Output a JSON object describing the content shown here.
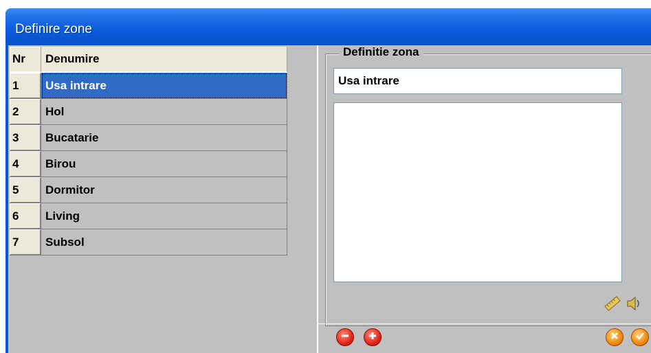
{
  "window": {
    "title": "Definire zone"
  },
  "grid": {
    "columns": [
      "Nr",
      "Denumire"
    ],
    "rows": [
      {
        "nr": "1",
        "name": "Usa intrare"
      },
      {
        "nr": "2",
        "name": "Hol"
      },
      {
        "nr": "3",
        "name": "Bucatarie"
      },
      {
        "nr": "4",
        "name": "Birou"
      },
      {
        "nr": "5",
        "name": "Dormitor"
      },
      {
        "nr": "6",
        "name": "Living"
      },
      {
        "nr": "7",
        "name": "Subsol"
      }
    ],
    "selected_row": "1"
  },
  "definition": {
    "group_label": "Definitie zona",
    "name_value": "Usa intrare",
    "description_value": ""
  },
  "icons": {
    "tools": [
      "ruler-icon",
      "speaker-icon"
    ],
    "bottom_left": [
      "remove-icon",
      "add-icon"
    ],
    "bottom_right": [
      "cancel-icon",
      "confirm-icon"
    ]
  },
  "colors": {
    "titlebar": "#0a55d8",
    "selection": "#316ac5",
    "header_bg": "#ece9d8",
    "panel_bg": "#c0c0c0",
    "remove_add": "#e0261a",
    "cancel_confirm": "#f08a10"
  }
}
